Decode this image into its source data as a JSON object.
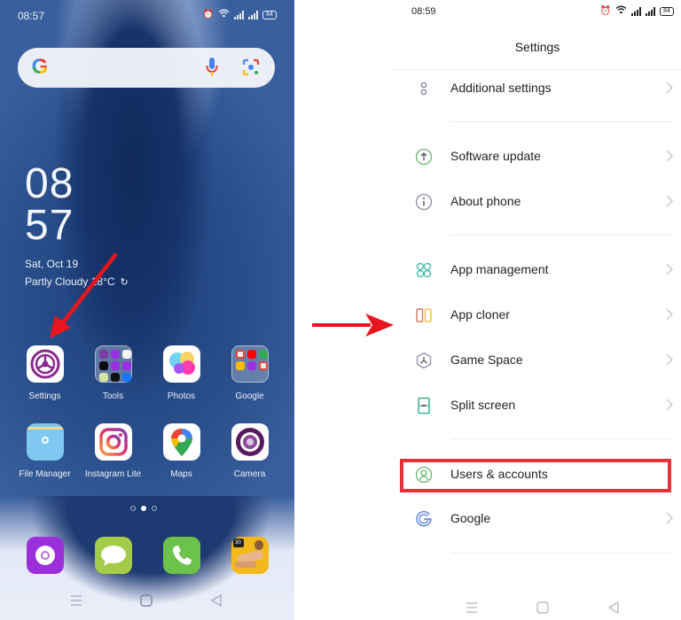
{
  "left_screen": {
    "status_bar": {
      "time": "08:57",
      "icons": [
        "alarm-icon",
        "wifi-icon",
        "signal-icon",
        "signal-icon"
      ],
      "battery": "84"
    },
    "search_bar": {
      "logo": "G",
      "icons": [
        "google-g-icon",
        "microphone-icon",
        "google-lens-icon"
      ]
    },
    "clock": {
      "hour": "08",
      "minute": "57"
    },
    "date": "Sat, Oct 19",
    "weather": {
      "text": "Partly Cloudy 18°C",
      "refresh_icon": "↻"
    },
    "apps": [
      {
        "label": "Settings",
        "icon": "settings-icon"
      },
      {
        "label": "Tools",
        "icon": "folder-icon"
      },
      {
        "label": "Photos",
        "icon": "photos-icon"
      },
      {
        "label": "Google",
        "icon": "folder-icon"
      },
      {
        "label": "File Manager",
        "icon": "file-manager-icon"
      },
      {
        "label": "Instagram Lite",
        "icon": "instagram-icon"
      },
      {
        "label": "Maps",
        "icon": "maps-icon"
      },
      {
        "label": "Camera",
        "icon": "camera-icon"
      }
    ],
    "page_indicator": {
      "total": 3,
      "active": 2
    },
    "dock": [
      {
        "name": "browser",
        "icon": "browser-icon",
        "color": "#9b2fd9"
      },
      {
        "name": "messages",
        "icon": "messages-icon",
        "color": "#a3cc4a"
      },
      {
        "name": "phone",
        "icon": "phone-icon",
        "color": "#6cc24a"
      },
      {
        "name": "fitness",
        "icon": "fitness-icon",
        "color": "#f2b81e",
        "badge": "30"
      }
    ],
    "nav": [
      "menu-icon",
      "home-icon",
      "back-icon"
    ]
  },
  "annotation": {
    "arrow_color": "#e8161c",
    "highlight_color": "#e53238"
  },
  "right_screen": {
    "status_bar": {
      "time": "08:59",
      "icons": [
        "alarm-icon",
        "wifi-icon",
        "signal-icon",
        "signal-icon"
      ],
      "battery": "84"
    },
    "title": "Settings",
    "items": [
      {
        "label": "Additional settings",
        "icon": "additional-settings-icon",
        "chevron": true
      },
      {
        "label": "Software update",
        "icon": "software-update-icon",
        "chevron": true
      },
      {
        "label": "About phone",
        "icon": "info-icon",
        "chevron": true
      },
      {
        "label": "App management",
        "icon": "app-management-icon",
        "chevron": true
      },
      {
        "label": "App cloner",
        "icon": "app-cloner-icon",
        "chevron": true
      },
      {
        "label": "Game Space",
        "icon": "game-space-icon",
        "chevron": true
      },
      {
        "label": "Split screen",
        "icon": "split-screen-icon",
        "chevron": true
      },
      {
        "label": "Users & accounts",
        "icon": "user-icon",
        "chevron": false,
        "highlighted": true
      },
      {
        "label": "Google",
        "icon": "google-icon",
        "chevron": true
      }
    ],
    "nav": [
      "menu-icon",
      "home-icon",
      "back-icon"
    ]
  }
}
